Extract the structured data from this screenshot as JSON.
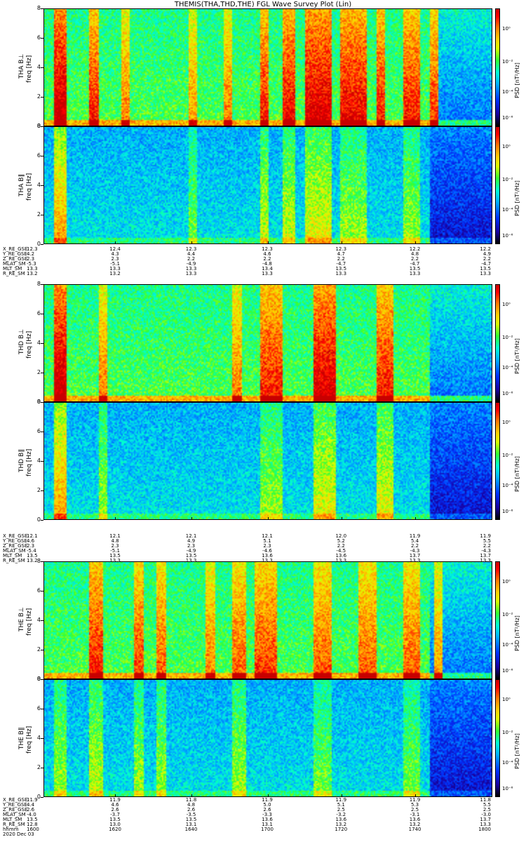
{
  "title": "THEMIS(THA,THD,THE) FGL Wave Survey Plot (Lin)",
  "colors": {
    "low": "#000000",
    "mid": "#00ffff",
    "high": "#ff0000"
  },
  "chart_data": {
    "type": "heatmap",
    "ylim": [
      0,
      8
    ],
    "yticks": [
      "0",
      "2",
      "4",
      "6",
      "8"
    ],
    "colorbar_label": "PSD [nT²/Hz]",
    "colorbar_ticks": [
      "10⁰",
      "10⁻²",
      "10⁻⁴",
      "10⁻⁶"
    ],
    "panels": [
      {
        "ylabel": "THA B⊥",
        "ylabel2": "freq [Hz]",
        "bands": [
          [
            0.02,
            0.05,
            0.7
          ],
          [
            0.1,
            0.12,
            0.55
          ],
          [
            0.17,
            0.19,
            0.4
          ],
          [
            0.32,
            0.34,
            0.35
          ],
          [
            0.4,
            0.42,
            0.4
          ],
          [
            0.48,
            0.5,
            0.55
          ],
          [
            0.53,
            0.56,
            0.6
          ],
          [
            0.58,
            0.64,
            0.65
          ],
          [
            0.66,
            0.72,
            0.6
          ],
          [
            0.74,
            0.76,
            0.55
          ],
          [
            0.8,
            0.84,
            0.55
          ],
          [
            0.86,
            0.88,
            0.5
          ]
        ],
        "quiet_right": true
      },
      {
        "ylabel": "THA B∥",
        "ylabel2": "freq [Hz]",
        "bands": [
          [
            0.02,
            0.05,
            0.55
          ],
          [
            0.32,
            0.34,
            0.25
          ],
          [
            0.48,
            0.5,
            0.35
          ],
          [
            0.53,
            0.56,
            0.35
          ],
          [
            0.58,
            0.64,
            0.4
          ],
          [
            0.66,
            0.72,
            0.3
          ],
          [
            0.8,
            0.84,
            0.3
          ]
        ],
        "quiet_right": true
      },
      {
        "ylabel": "THD B⊥",
        "ylabel2": "freq [Hz]",
        "bands": [
          [
            0.02,
            0.05,
            0.7
          ],
          [
            0.12,
            0.14,
            0.4
          ],
          [
            0.42,
            0.44,
            0.4
          ],
          [
            0.48,
            0.53,
            0.55
          ],
          [
            0.6,
            0.65,
            0.65
          ],
          [
            0.74,
            0.78,
            0.55
          ]
        ],
        "quiet_right": true
      },
      {
        "ylabel": "THD B∥",
        "ylabel2": "freq [Hz]",
        "bands": [
          [
            0.02,
            0.05,
            0.55
          ],
          [
            0.12,
            0.14,
            0.3
          ],
          [
            0.48,
            0.53,
            0.3
          ],
          [
            0.6,
            0.65,
            0.4
          ],
          [
            0.74,
            0.78,
            0.4
          ]
        ],
        "quiet_right": true
      },
      {
        "ylabel": "THE B⊥",
        "ylabel2": "freq [Hz]",
        "bands": [
          [
            0.1,
            0.13,
            0.55
          ],
          [
            0.2,
            0.22,
            0.5
          ],
          [
            0.25,
            0.27,
            0.45
          ],
          [
            0.36,
            0.38,
            0.4
          ],
          [
            0.42,
            0.45,
            0.45
          ],
          [
            0.47,
            0.52,
            0.5
          ],
          [
            0.6,
            0.64,
            0.45
          ],
          [
            0.7,
            0.74,
            0.45
          ],
          [
            0.8,
            0.84,
            0.45
          ],
          [
            0.87,
            0.89,
            0.35
          ]
        ],
        "quiet_right": true
      },
      {
        "ylabel": "THE B∥",
        "ylabel2": "freq [Hz]",
        "bands": [
          [
            0.02,
            0.05,
            0.3
          ],
          [
            0.1,
            0.13,
            0.35
          ],
          [
            0.2,
            0.22,
            0.3
          ],
          [
            0.25,
            0.27,
            0.3
          ],
          [
            0.42,
            0.45,
            0.3
          ],
          [
            0.6,
            0.64,
            0.25
          ],
          [
            0.8,
            0.84,
            0.25
          ]
        ],
        "quiet_right": true
      }
    ],
    "ephemeris": [
      {
        "rows": [
          {
            "label": "X_RE_GSE",
            "values": [
              "12.3",
              "12.4",
              "12.3",
              "12.3",
              "12.3",
              "12.2",
              "12.2"
            ]
          },
          {
            "label": "Y_RE_GSE",
            "values": [
              "4.2",
              "4.3",
              "4.4",
              "4.6",
              "4.7",
              "4.8",
              "4.9"
            ]
          },
          {
            "label": "Z_RE_GSE",
            "values": [
              "2.3",
              "2.3",
              "2.2",
              "2.2",
              "2.2",
              "2.2",
              "2.2"
            ]
          },
          {
            "label": "MLAT_SM",
            "values": [
              "-5.3",
              "-5.1",
              "-4.9",
              "-4.8",
              "-4.7",
              "-4.7",
              "-4.7"
            ]
          },
          {
            "label": "MLT_SM",
            "values": [
              "13.3",
              "13.3",
              "13.3",
              "13.4",
              "13.5",
              "13.5",
              "13.5"
            ]
          },
          {
            "label": "R_RE_SM",
            "values": [
              "13.2",
              "13.2",
              "13.3",
              "13.3",
              "13.3",
              "13.3",
              "13.3"
            ]
          }
        ]
      },
      {
        "rows": [
          {
            "label": "X_RE_GSE",
            "values": [
              "12.1",
              "12.1",
              "12.1",
              "12.1",
              "12.0",
              "11.9",
              "11.9"
            ]
          },
          {
            "label": "Y_RE_GSE",
            "values": [
              "4.6",
              "4.8",
              "4.9",
              "5.1",
              "5.2",
              "5.4",
              "5.5"
            ]
          },
          {
            "label": "Z_RE_GSE",
            "values": [
              "2.3",
              "2.3",
              "2.3",
              "2.3",
              "2.2",
              "2.2",
              "2.2"
            ]
          },
          {
            "label": "MLAT_SM",
            "values": [
              "-5.4",
              "-5.1",
              "-4.9",
              "-4.6",
              "-4.5",
              "-4.3",
              "-4.3"
            ]
          },
          {
            "label": "MLT_SM",
            "values": [
              "13.5",
              "13.5",
              "13.5",
              "13.6",
              "13.6",
              "13.7",
              "13.7"
            ]
          },
          {
            "label": "R_RE_SM",
            "values": [
              "13.2",
              "13.3",
              "13.3",
              "13.3",
              "13.3",
              "13.3",
              "13.3"
            ]
          }
        ]
      },
      {
        "rows": [
          {
            "label": "X_RE_GSE",
            "values": [
              "11.9",
              "11.9",
              "11.8",
              "11.9",
              "11.9",
              "11.9",
              "11.8"
            ]
          },
          {
            "label": "Y_RE_GSE",
            "values": [
              "4.4",
              "4.6",
              "4.8",
              "5.0",
              "5.1",
              "5.3",
              "5.5"
            ]
          },
          {
            "label": "Z_RE_GSE",
            "values": [
              "2.6",
              "2.6",
              "2.6",
              "2.6",
              "2.5",
              "2.5",
              "2.5"
            ]
          },
          {
            "label": "MLAT_SM",
            "values": [
              "-4.0",
              "-3.7",
              "-3.5",
              "-3.3",
              "-3.2",
              "-3.1",
              "-3.0"
            ]
          },
          {
            "label": "MLT_SM",
            "values": [
              "13.5",
              "13.5",
              "13.5",
              "13.6",
              "13.6",
              "13.6",
              "13.7"
            ]
          },
          {
            "label": "R_RE_SM",
            "values": [
              "12.8",
              "13.0",
              "13.1",
              "13.1",
              "13.2",
              "13.2",
              "13.3"
            ]
          },
          {
            "label": "hhmm",
            "values": [
              "1600",
              "1620",
              "1640",
              "1700",
              "1720",
              "1740",
              "1800"
            ]
          }
        ]
      }
    ],
    "date": "2020 Dec 03"
  }
}
